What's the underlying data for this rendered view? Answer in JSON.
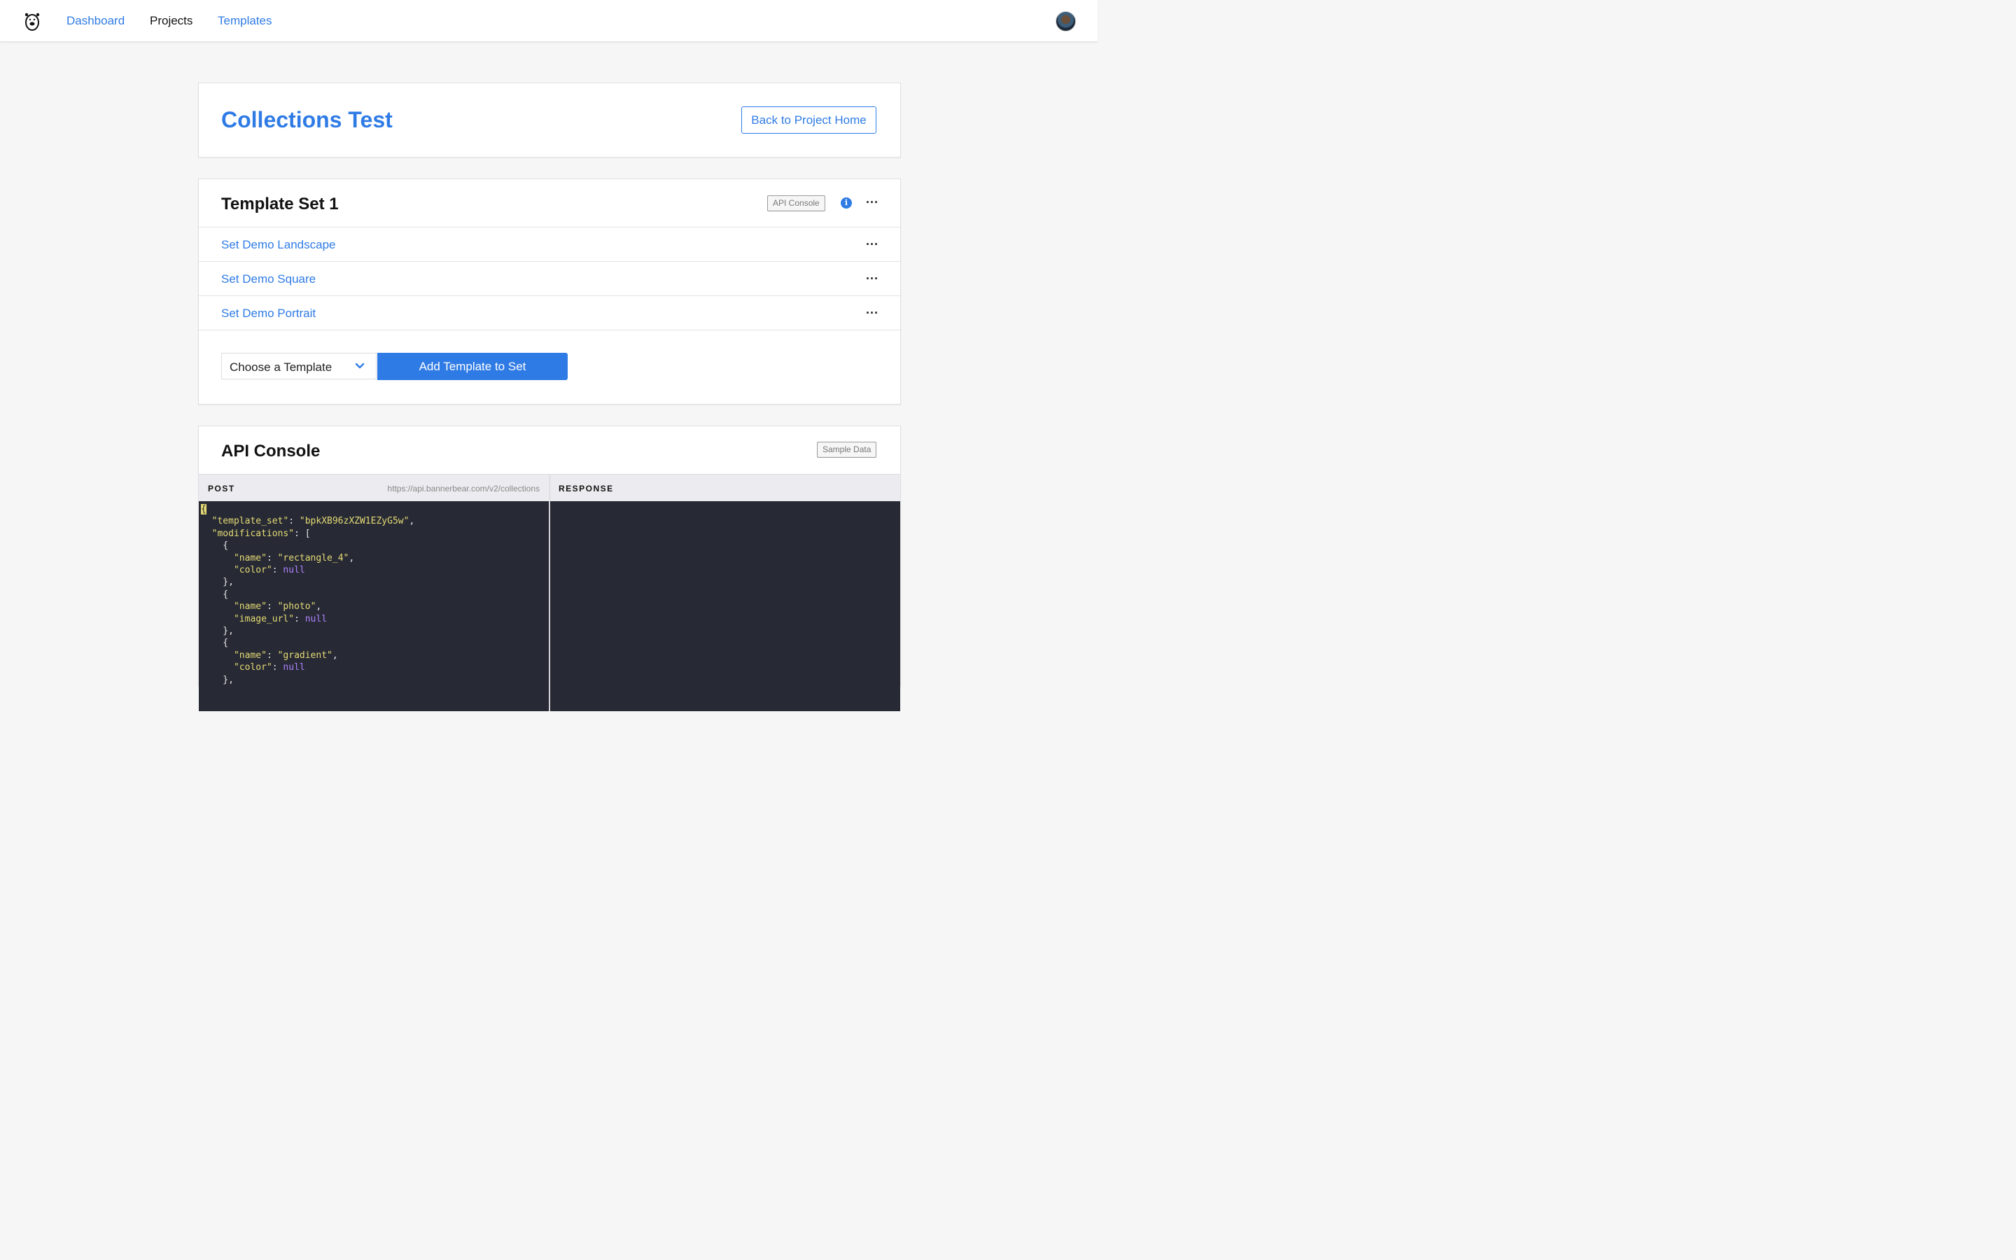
{
  "nav": {
    "items": [
      {
        "label": "Dashboard"
      },
      {
        "label": "Projects"
      },
      {
        "label": "Templates"
      }
    ]
  },
  "header": {
    "title": "Collections Test",
    "back_button": "Back to Project Home"
  },
  "template_set": {
    "title": "Template Set 1",
    "api_console_badge": "API Console",
    "info_icon": "i",
    "more_icon": "···",
    "templates": [
      {
        "label": "Set Demo Landscape"
      },
      {
        "label": "Set Demo Square"
      },
      {
        "label": "Set Demo Portrait"
      }
    ],
    "select_value": "Choose a Template",
    "add_button": "Add Template to Set"
  },
  "api_console": {
    "title": "API Console",
    "sample_badge": "Sample Data",
    "post_label": "POST",
    "url": "https://api.bannerbear.com/v2/collections",
    "response_label": "RESPONSE",
    "code": {
      "template_set_value": "bpkXB96zXZW1EZyG5w",
      "mods": [
        {
          "key": "color",
          "name": "rectangle_4"
        },
        {
          "key": "image_url",
          "name": "photo"
        },
        {
          "key": "color",
          "name": "gradient"
        }
      ]
    }
  },
  "colors": {
    "accent": "#2f7be5",
    "code_bg": "#272a35",
    "code_string": "#e6db74",
    "code_null": "#ae81ff"
  }
}
